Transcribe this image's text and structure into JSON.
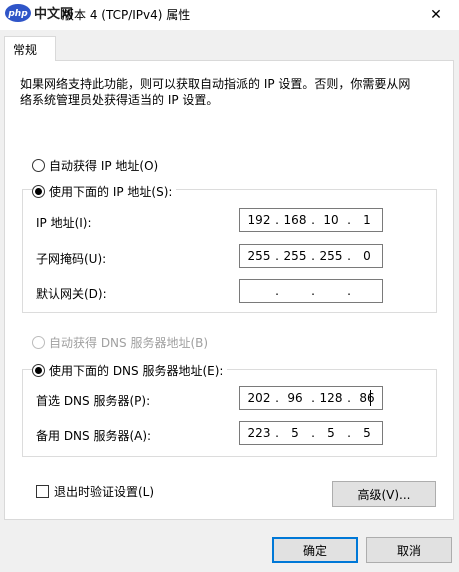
{
  "window": {
    "title": "版本 4 (TCP/IPv4) 属性",
    "logo_text": "php 中文网",
    "close_glyph": "✕"
  },
  "tabs": [
    {
      "label": "常规"
    }
  ],
  "description": {
    "line1": "如果网络支持此功能，则可以获取自动指派的 IP 设置。否则，你需要从网",
    "line2": "络系统管理员处获得适当的 IP 设置。"
  },
  "ip_section": {
    "auto_label": "自动获得 IP 地址(O)",
    "manual_label": "使用下面的 IP 地址(S):",
    "ip_label": "IP 地址(I):",
    "ip_value": [
      "192",
      "168",
      "10",
      "1"
    ],
    "subnet_label": "子网掩码(U):",
    "subnet_value": [
      "255",
      "255",
      "255",
      "0"
    ],
    "gateway_label": "默认网关(D):",
    "gateway_value": [
      "",
      "",
      "",
      ""
    ]
  },
  "dns_section": {
    "auto_label": "自动获得 DNS 服务器地址(B)",
    "manual_label": "使用下面的 DNS 服务器地址(E):",
    "preferred_label": "首选 DNS 服务器(P):",
    "preferred_value": [
      "202",
      "96",
      "128",
      "86"
    ],
    "alternate_label": "备用 DNS 服务器(A):",
    "alternate_value": [
      "223",
      "5",
      "5",
      "5"
    ]
  },
  "validate_label": "退出时验证设置(L)",
  "buttons": {
    "advanced": "高级(V)...",
    "ok": "确定",
    "cancel": "取消"
  }
}
